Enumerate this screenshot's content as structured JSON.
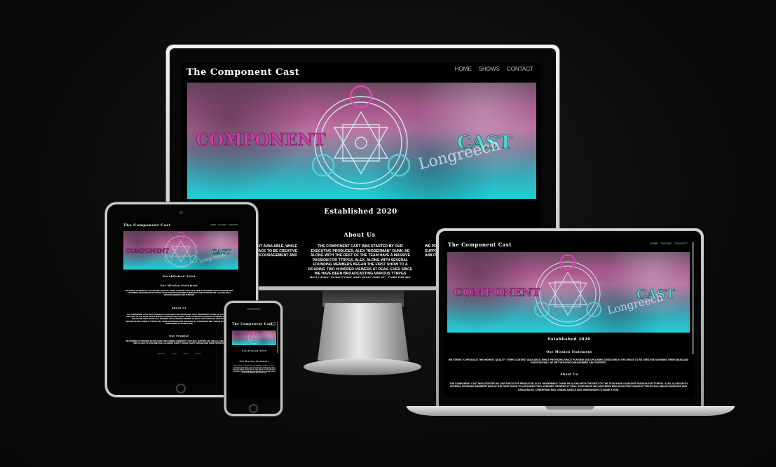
{
  "site": {
    "title": "The Component Cast",
    "nav": [
      "Home",
      "Shows",
      "Contact"
    ],
    "hero": {
      "left_word": "COMPONENT",
      "right_word": "CAST",
      "overlay_word": "Longreech"
    },
    "established": "Established 2020",
    "mission_heading": "Our Mission Statement",
    "mission_text": "We strive to produce the highest quality TTRPG content available, while providing space for new and upcoming creators in the space to be creative knowing their ideas and passions will be met with encouragement and support",
    "about_heading": "About Us",
    "about_text": "The Component Cast was started by our executive producer, Alex \"Moderman\" Dunn. He along with the rest of the team have a massive passion for TTRPGs. Alex, along with several founding members began the first show to a roaring two hundred viewers at peak. Ever since we have been broadcasting various TTRPGs including Dungeons and Dragons 5e, Cyberpunk Red, Urban Jungle and Zweihander to name a few.",
    "promise_heading": "Our Promise",
    "promise_text": "We promise to provide an inclusive, welcoming community that will support any and all creators to the fullest of our abilities, allowing them to grow, adapt and become their potential",
    "footer_links": [
      "Facebook",
      "Twitter",
      "Twitch",
      "Discord"
    ]
  },
  "colors": {
    "background": "#0d0d0d",
    "magenta": "#d23cab",
    "cyan": "#45e0d8"
  }
}
